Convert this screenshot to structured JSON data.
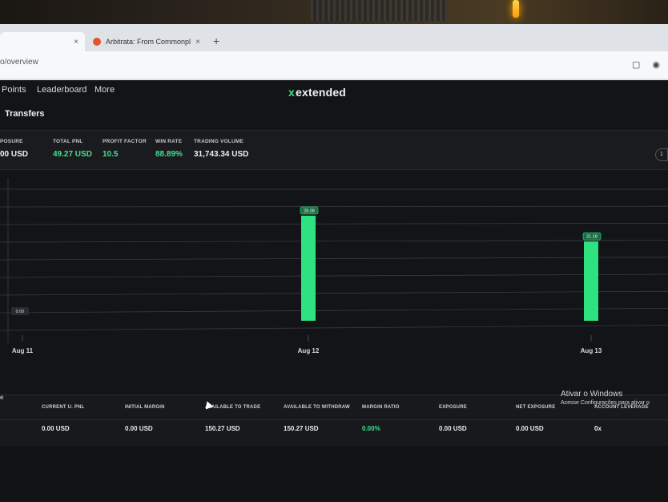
{
  "browser": {
    "tab_active_close": "×",
    "tab2_title": "Arbitrata: From Commonpl",
    "tab2_close": "×",
    "new_tab": "+",
    "address": "o/overview"
  },
  "nav": {
    "items": [
      "Points",
      "Leaderboard",
      "More"
    ],
    "logo_mark": "x",
    "logo_text": "extended",
    "sub_item": "Transfers"
  },
  "stats": [
    {
      "label": "POSURE",
      "value": "00 USD",
      "color": "white"
    },
    {
      "label": "TOTAL PNL",
      "value": "49.27 USD",
      "color": "green"
    },
    {
      "label": "PROFIT FACTOR",
      "value": "10.5",
      "color": "green"
    },
    {
      "label": "WIN RATE",
      "value": "88.89%",
      "color": "green"
    },
    {
      "label": "TRADING VOLUME",
      "value": "31,743.34 USD",
      "color": "white"
    }
  ],
  "stats_pill": "1",
  "chart_data": {
    "type": "bar",
    "categories": [
      "Aug 11",
      "Aug 12",
      "Aug 13"
    ],
    "values": [
      0.0,
      28.08,
      21.18
    ],
    "data_labels": [
      "0.00",
      "28.08",
      "21.18"
    ],
    "grid": true,
    "bar_color": "#2ee37f"
  },
  "table": {
    "edge_label": "e",
    "headers": [
      "CURRENT U. PNL",
      "INITIAL MARGIN",
      "AVAILABLE TO TRADE",
      "AVAILABLE TO WITHDRAW",
      "MARGIN RATIO",
      "EXPOSURE",
      "NET EXPOSURE",
      "ACCOUNT LEVERAGE"
    ],
    "values": [
      "0.00 USD",
      "0.00 USD",
      "150.27 USD",
      "150.27 USD",
      "0.00%",
      "0.00 USD",
      "0.00 USD",
      "0x"
    ]
  },
  "watermark": {
    "title": "Ativar o Windows",
    "subtitle": "Acesse Configurações para ativar o"
  },
  "colors": {
    "accent": "#43e08e",
    "background": "#131417"
  }
}
